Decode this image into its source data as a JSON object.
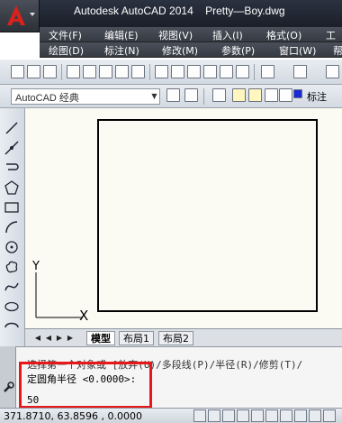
{
  "window": {
    "title": "Autodesk AutoCAD 2014    Pretty—Boy.dwg"
  },
  "menu_row1": [
    {
      "label": "文件(F)"
    },
    {
      "label": "编辑(E)"
    },
    {
      "label": "视图(V)"
    },
    {
      "label": "插入(I)"
    },
    {
      "label": "格式(O)"
    },
    {
      "label": "工"
    }
  ],
  "menu_row2": [
    {
      "label": "绘图(D)"
    },
    {
      "label": "标注(N)"
    },
    {
      "label": "修改(M)"
    },
    {
      "label": "参数(P)"
    },
    {
      "label": "窗口(W)"
    },
    {
      "label": "帮"
    }
  ],
  "workspace": {
    "selected": "AutoCAD 经典",
    "layer_label": "标注"
  },
  "ucs": {
    "y": "Y",
    "x": "X"
  },
  "tabs": {
    "model": "模型",
    "layout1": "布局1",
    "layout2": "布局2"
  },
  "command": {
    "history": "选择第一个对象或 [放弃(U)/多段线(P)/半径(R)/修剪(T)/",
    "prompt": "定圆角半径 <0.0000>:",
    "input": "50"
  },
  "status": {
    "coordinates": "371.8710, 63.8596 , 0.0000"
  },
  "colors": {
    "highlight_border": "#e81818",
    "canvas": "#fcfbf3",
    "titlebar": "#1f2430"
  }
}
